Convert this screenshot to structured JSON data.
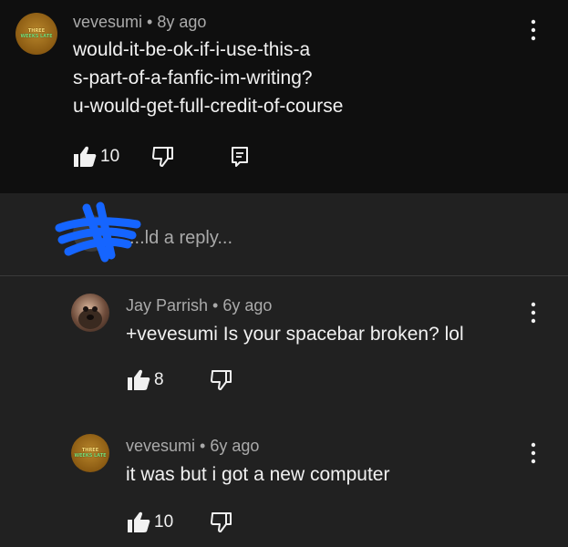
{
  "comment": {
    "author": "vevesumi",
    "time": "8y ago",
    "lines": [
      "would-it-be-ok-if-i-use-this-a",
      "s-part-of-a-fanfic-im-writing?",
      "u-would-get-full-credit-of-course"
    ],
    "likes": "10",
    "avatar_text_1": "THREE",
    "avatar_text_2": "WEEKS LATE"
  },
  "reply_box": {
    "placeholder": "...ld a reply..."
  },
  "replies": [
    {
      "author": "Jay Parrish",
      "time": "6y ago",
      "text": "+vevesumi Is your spacebar broken? lol",
      "likes": "8"
    },
    {
      "author": "vevesumi",
      "time": "6y ago",
      "text": "it was but i got a new computer",
      "likes": "10",
      "avatar_text_1": "THREE",
      "avatar_text_2": "WEEKS LATE"
    }
  ],
  "separator": "•",
  "icons": {
    "like": "thumbs-up-icon",
    "dislike": "thumbs-down-icon",
    "reply": "reply-icon",
    "menu": "more-vert-icon"
  },
  "colors": {
    "top_background": "#0f0f0f",
    "background": "#212121",
    "text": "#f1f1f1",
    "muted": "#aaaaaa",
    "redaction": "#1565ff"
  }
}
